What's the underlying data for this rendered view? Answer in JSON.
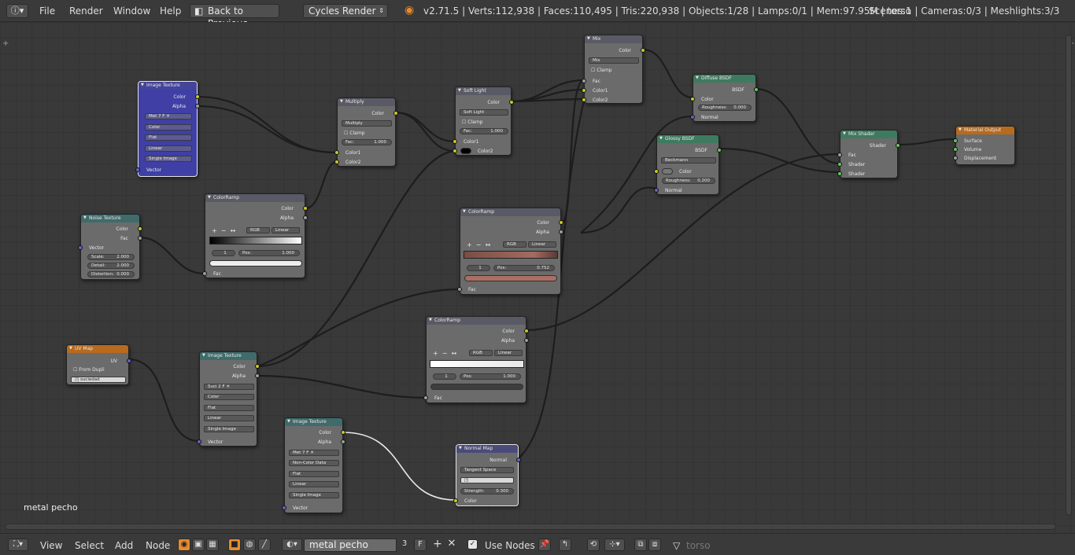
{
  "topbar": {
    "menus": [
      "File",
      "Render",
      "Window",
      "Help"
    ],
    "back_label": "Back to Previous",
    "engine": "Cycles Render",
    "stats": "v2.71.5 | Verts:112,938 | Faces:110,495 | Tris:220,938 | Objects:1/28 | Lamps:0/1 | Mem:97.95M | torso",
    "scene_stats": "Scenes:1 | Cameras:0/3 | Meshlights:3/3"
  },
  "editor": {
    "material_label": "metal pecho"
  },
  "nodes": {
    "image_texture_1": {
      "title": "Image Texture",
      "out_color": "Color",
      "out_alpha": "Alpha",
      "img": "Met",
      "users": "7",
      "f": "F",
      "proj": "Color",
      "interp": "Flat",
      "ext": "Linear",
      "src": "Single Image",
      "in_vector": "Vector"
    },
    "noise": {
      "title": "Noise Texture",
      "out_color": "Color",
      "out_fac": "Fac",
      "in_vector": "Vector",
      "scale": "Scale:",
      "scale_v": "2.000",
      "detail": "Detail:",
      "detail_v": "2.000",
      "distortion": "Distortion:",
      "distortion_v": "0.000"
    },
    "ramp_1": {
      "title": "ColorRamp",
      "out_color": "Color",
      "out_alpha": "Alpha",
      "mode": "RGB",
      "interp": "Linear",
      "idx": "1",
      "pos": "Pos:",
      "pos_v": "1.000",
      "in_fac": "Fac"
    },
    "multiply": {
      "title": "Multiply",
      "out_color": "Color",
      "blend": "Multiply",
      "clamp": "Clamp",
      "fac": "Fac:",
      "fac_v": "1.000",
      "in_c1": "Color1",
      "in_c2": "Color2"
    },
    "softlight": {
      "title": "Soft Light",
      "out_color": "Color",
      "blend": "Soft Light",
      "clamp": "Clamp",
      "fac": "Fac:",
      "fac_v": "1.000",
      "in_c1": "Color1",
      "in_c2": "Color2"
    },
    "mix": {
      "title": "Mix",
      "out_color": "Color",
      "blend": "Mix",
      "clamp": "Clamp",
      "in_fac": "Fac",
      "in_c1": "Color1",
      "in_c2": "Color2"
    },
    "diffuse": {
      "title": "Diffuse BSDF",
      "out": "BSDF",
      "in_color": "Color",
      "rough": "Roughness:",
      "rough_v": "0.000",
      "in_normal": "Normal"
    },
    "glossy": {
      "title": "Glossy BSDF",
      "out": "BSDF",
      "dist": "Beckmann",
      "in_color": "Color",
      "rough": "Roughness:",
      "rough_v": "0.200",
      "in_normal": "Normal"
    },
    "mixshader": {
      "title": "Mix Shader",
      "out": "Shader",
      "in_fac": "Fac",
      "in_s1": "Shader",
      "in_s2": "Shader"
    },
    "output": {
      "title": "Material Output",
      "in_surface": "Surface",
      "in_volume": "Volume",
      "in_disp": "Displacement"
    },
    "ramp_2": {
      "title": "ColorRamp",
      "out_color": "Color",
      "out_alpha": "Alpha",
      "mode": "RGB",
      "interp": "Linear",
      "idx": "1",
      "pos": "Pos:",
      "pos_v": "0.752",
      "in_fac": "Fac"
    },
    "ramp_3": {
      "title": "ColorRamp",
      "out_color": "Color",
      "out_alpha": "Alpha",
      "mode": "RGB",
      "interp": "Linear",
      "idx": "1",
      "pos": "Pos:",
      "pos_v": "1.000",
      "in_fac": "Fac"
    },
    "uvmap": {
      "title": "UV Map",
      "out": "UV",
      "from_dupli": "From Dupli",
      "uv": "suciedad"
    },
    "image_texture_2": {
      "title": "Image Texture",
      "out_color": "Color",
      "out_alpha": "Alpha",
      "img": "Suci",
      "users": "2",
      "f": "F",
      "proj": "Color",
      "interp": "Flat",
      "ext": "Linear",
      "src": "Single Image",
      "in_vector": "Vector"
    },
    "image_texture_3": {
      "title": "Image Texture",
      "out_color": "Color",
      "out_alpha": "Alpha",
      "img": "Met",
      "users": "7",
      "f": "F",
      "proj": "Non-Color Data",
      "interp": "Flat",
      "ext": "Linear",
      "src": "Single Image",
      "in_vector": "Vector"
    },
    "normalmap": {
      "title": "Normal Map",
      "out": "Normal",
      "space": "Tangent Space",
      "strength": "Strength:",
      "strength_v": "0.300",
      "in_color": "Color"
    }
  },
  "bottombar": {
    "menus": [
      "View",
      "Select",
      "Add",
      "Node"
    ],
    "material_name": "metal pecho",
    "users": "3",
    "f": "F",
    "use_nodes": "Use Nodes",
    "object": "torso"
  },
  "colors": {
    "accent": "#e68a2e",
    "texture_header": "#3f6b6b",
    "shader_header": "#3e7a5f",
    "input_header": "#b86a1d",
    "socket_color": "#c7c729",
    "socket_float": "#9d9d9d",
    "socket_vector": "#6363c7",
    "socket_shader": "#63c763"
  }
}
